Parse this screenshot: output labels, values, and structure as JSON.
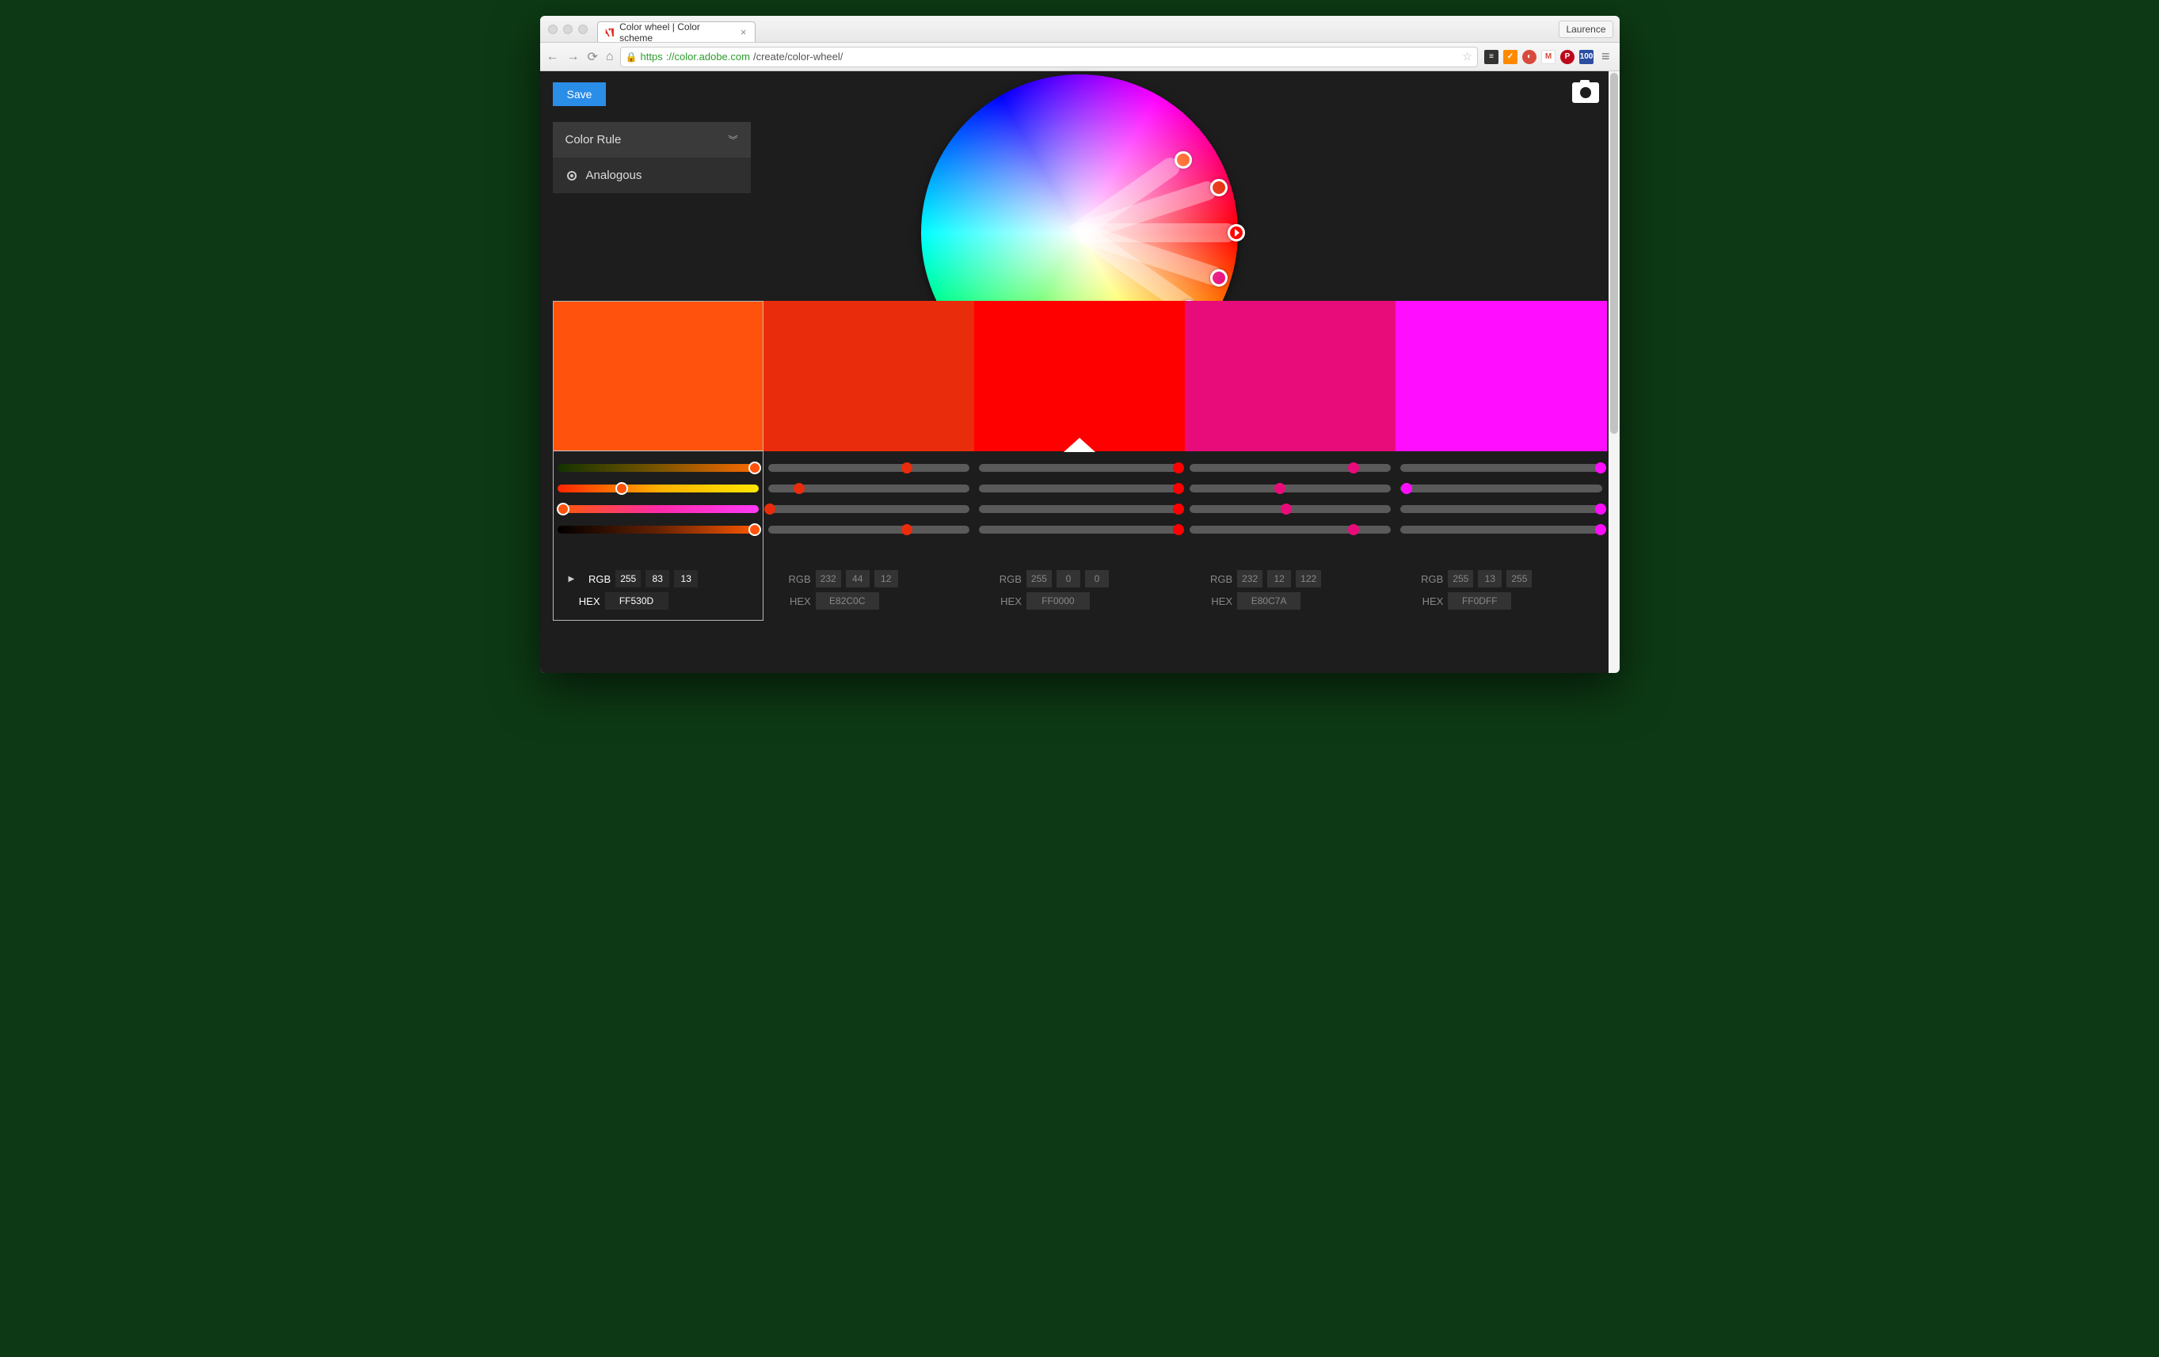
{
  "browser": {
    "tab_title": "Color wheel | Color scheme",
    "profile": "Laurence",
    "url_scheme": "https",
    "url_host": "://color.adobe.com",
    "url_path": "/create/color-wheel/"
  },
  "toolbar": {
    "save_label": "Save"
  },
  "rule": {
    "title": "Color Rule",
    "selected": "Analogous"
  },
  "labels": {
    "rgb": "RGB",
    "hex": "HEX"
  },
  "swatches": [
    {
      "hex": "FF530D",
      "rgb": [
        255,
        83,
        13
      ],
      "selected": true,
      "wheel_angle": 35,
      "wheel_radius": 160
    },
    {
      "hex": "E82C0C",
      "rgb": [
        232,
        44,
        12
      ],
      "selected": false,
      "wheel_angle": 18,
      "wheel_radius": 185
    },
    {
      "hex": "FF0000",
      "rgb": [
        255,
        0,
        0
      ],
      "selected": false,
      "wheel_angle": 0,
      "wheel_radius": 198,
      "base": true
    },
    {
      "hex": "E80C7A",
      "rgb": [
        232,
        12,
        122
      ],
      "selected": false,
      "wheel_angle": -18,
      "wheel_radius": 185
    },
    {
      "hex": "FF0DFF",
      "rgb": [
        255,
        13,
        255
      ],
      "selected": false,
      "wheel_angle": -35,
      "wheel_radius": 168
    }
  ],
  "slider_rows": [
    {
      "selected_gradient": "linear-gradient(90deg,#133300,#7a5500,#ff6a00)",
      "handle": 0.96,
      "dots": [
        0.68,
        0.97,
        0.8,
        0.97
      ]
    },
    {
      "selected_gradient": "linear-gradient(90deg,#ff2400,#ffb000,#ffe600)",
      "handle": 0.33,
      "dots": [
        0.17,
        0.97,
        0.45,
        0.05
      ]
    },
    {
      "selected_gradient": "linear-gradient(90deg,#ff5a00,#ff2aa8,#ff3af7)",
      "handle": 0.05,
      "dots": [
        0.03,
        0.97,
        0.48,
        0.97
      ]
    },
    {
      "selected_gradient": "linear-gradient(90deg,#000,#662100,#ff5a00)",
      "handle": 0.96,
      "dots": [
        0.68,
        0.97,
        0.8,
        0.97
      ]
    }
  ]
}
